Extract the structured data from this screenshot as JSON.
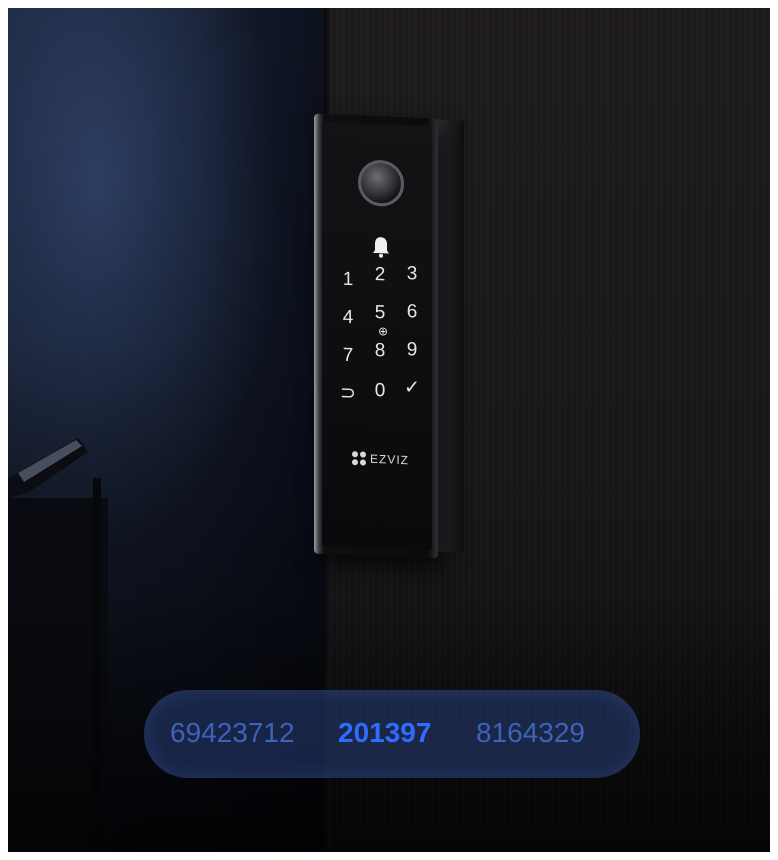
{
  "keypad": {
    "rows": [
      [
        "1",
        "2",
        "3"
      ],
      [
        "4",
        "5",
        "6"
      ],
      [
        "7",
        "8",
        "9"
      ],
      [
        "⊃",
        "0",
        "✓"
      ]
    ]
  },
  "icons": {
    "doorbell": "bell-icon",
    "fingerprint": "fingerprint-sensor-icon",
    "nfc": "card-reader-icon"
  },
  "brand": {
    "name": "EZVIZ"
  },
  "codes": {
    "previous": "69423712",
    "current": "201397",
    "next": "8164329"
  },
  "colors": {
    "code_current": "#2f6bff",
    "code_dim": "#3d63b8",
    "pill": "#283e78"
  }
}
